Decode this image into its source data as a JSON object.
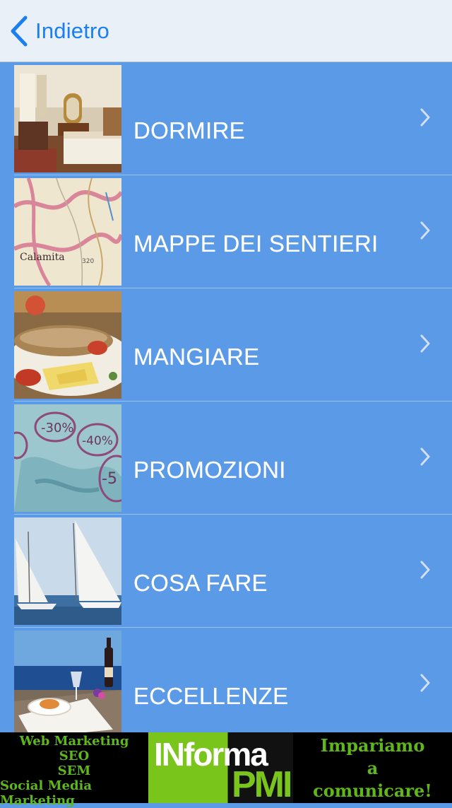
{
  "navbar": {
    "back_label": "Indietro"
  },
  "menu": {
    "items": [
      {
        "label": "DORMIRE",
        "icon": "hotel-room-photo"
      },
      {
        "label": "MAPPE DEI SENTIERI",
        "icon": "trail-map-photo"
      },
      {
        "label": "MANGIARE",
        "icon": "fish-dish-photo"
      },
      {
        "label": "PROMOZIONI",
        "icon": "discount-tags-photo"
      },
      {
        "label": "COSA FARE",
        "icon": "sailboats-photo"
      },
      {
        "label": "ECCELLENZE",
        "icon": "wine-seaside-photo"
      }
    ]
  },
  "ad": {
    "left_lines": [
      "Web Marketing",
      "SEO",
      "SEM",
      "Social Media Marketing"
    ],
    "logo_top": "INforma",
    "logo_bottom": "PMI",
    "right_lines": [
      "Impariamo",
      "a",
      "comunicare!"
    ]
  },
  "colors": {
    "list_background": "#5b9ae6",
    "navbar_background": "#eaf0f8",
    "accent": "#1a7ff0",
    "ad_green": "#5fb81a"
  }
}
